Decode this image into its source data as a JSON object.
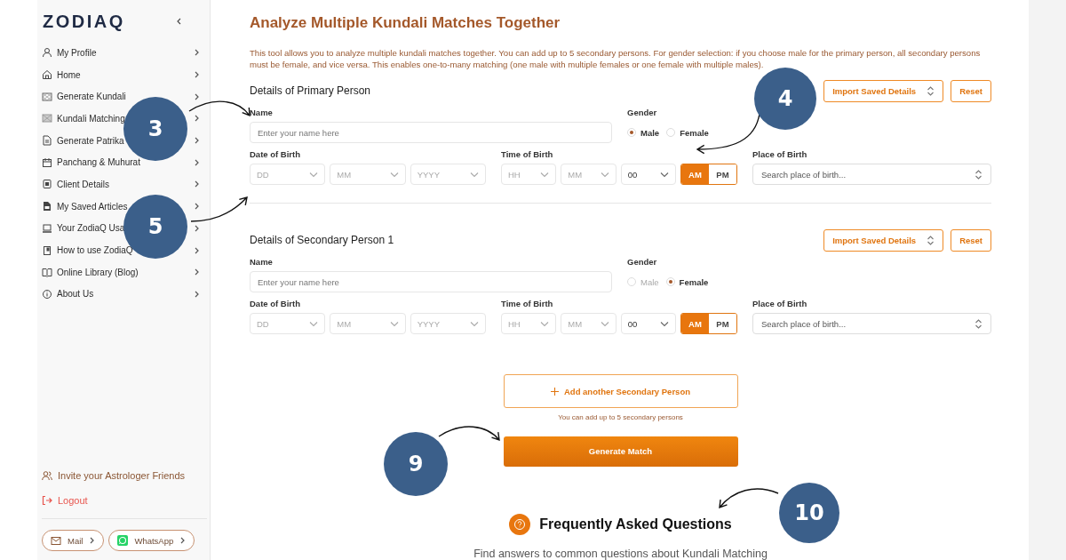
{
  "sidebar": {
    "logo": "ZODIAQ",
    "items": [
      {
        "label": "My Profile"
      },
      {
        "label": "Home"
      },
      {
        "label": "Generate Kundali"
      },
      {
        "label": "Kundali Matching"
      },
      {
        "label": "Generate Patrika"
      },
      {
        "label": "Panchang & Muhurat"
      },
      {
        "label": "Client Details"
      },
      {
        "label": "My Saved Articles"
      },
      {
        "label": "Your ZodiaQ Usa"
      },
      {
        "label": "How to use ZodiaQ"
      },
      {
        "label": "Online Library (Blog)"
      },
      {
        "label": "About Us"
      }
    ],
    "invite": "Invite your Astrologer Friends",
    "logout": "Logout",
    "contacts": [
      {
        "label": "Mail"
      },
      {
        "label": "WhatsApp"
      }
    ]
  },
  "title": "Analyze Multiple Kundali Matches Together",
  "description": "This tool allows you to analyze multiple kundali matches together. You can add up to 5 secondary persons. For gender selection: if you choose male for the primary person, all secondary persons must be female, and vice versa. This enables one-to-many matching (one male with multiple females or one female with multiple males).",
  "persons": [
    {
      "heading": "Details of Primary Person",
      "import_button": "Import Saved Details",
      "reset_button": "Reset",
      "name_label": "Name",
      "name_placeholder": "Enter your name here",
      "gender_label": "Gender",
      "genders": [
        {
          "label": "Male",
          "selected": true,
          "disabled": false
        },
        {
          "label": "Female",
          "selected": false,
          "disabled": false
        }
      ],
      "dob_label": "Date of Birth",
      "dob": [
        {
          "placeholder": "DD"
        },
        {
          "placeholder": "MM"
        },
        {
          "placeholder": "YYYY"
        }
      ],
      "tob_label": "Time of Birth",
      "tob": [
        {
          "placeholder": "HH"
        },
        {
          "placeholder": "MM"
        },
        {
          "value": "00"
        }
      ],
      "meridiem": [
        {
          "label": "AM",
          "selected": true
        },
        {
          "label": "PM",
          "selected": false
        }
      ],
      "pob_label": "Place of Birth",
      "pob_placeholder": "Search place of birth..."
    },
    {
      "heading": "Details of Secondary Person 1",
      "import_button": "Import Saved Details",
      "reset_button": "Reset",
      "name_label": "Name",
      "name_placeholder": "Enter your name here",
      "gender_label": "Gender",
      "genders": [
        {
          "label": "Male",
          "selected": false,
          "disabled": true
        },
        {
          "label": "Female",
          "selected": true,
          "disabled": false
        }
      ],
      "dob_label": "Date of Birth",
      "dob": [
        {
          "placeholder": "DD"
        },
        {
          "placeholder": "MM"
        },
        {
          "placeholder": "YYYY"
        }
      ],
      "tob_label": "Time of Birth",
      "tob": [
        {
          "placeholder": "HH"
        },
        {
          "placeholder": "MM"
        },
        {
          "value": "00"
        }
      ],
      "meridiem": [
        {
          "label": "AM",
          "selected": true
        },
        {
          "label": "PM",
          "selected": false
        }
      ],
      "pob_label": "Place of Birth",
      "pob_placeholder": "Search place of birth..."
    }
  ],
  "add_button": "Add another Secondary Person",
  "add_hint": "You can add up to 5 secondary persons",
  "generate_button": "Generate Match",
  "faq": {
    "title": "Frequently Asked Questions",
    "subtitle": "Find answers to common questions about Kundali Matching"
  },
  "callouts": [
    {
      "number": "3"
    },
    {
      "number": "5"
    },
    {
      "number": "4"
    },
    {
      "number": "9"
    },
    {
      "number": "10"
    }
  ]
}
